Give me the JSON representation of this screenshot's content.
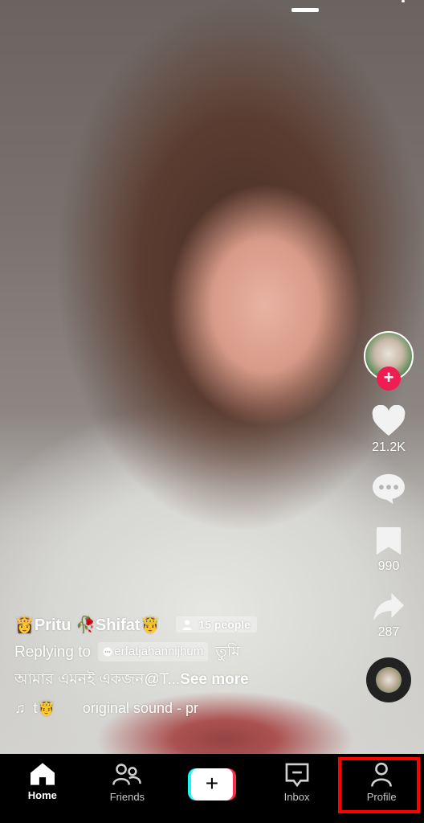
{
  "video": {
    "caption": {
      "username": "👸Pritu 🥀Shifat🤴",
      "viewer_badge": "15 people",
      "replying_prefix": "Replying to",
      "mention": "erfatjahannijhum",
      "text_line1_suffix": "তুমি",
      "text_line2": "আমার এমনই একজন@T...",
      "see_more": "See more",
      "sound_author": "t🤴",
      "sound_title": "original sound - pr"
    }
  },
  "rail": {
    "likes": "21.2K",
    "bookmarks": "990",
    "shares": "287",
    "follow_label": "+"
  },
  "nav": {
    "items": [
      {
        "label": "Home",
        "icon": "home-icon",
        "active": true
      },
      {
        "label": "Friends",
        "icon": "friends-icon"
      },
      {
        "label": "",
        "icon": "create-icon"
      },
      {
        "label": "Inbox",
        "icon": "inbox-icon"
      },
      {
        "label": "Profile",
        "icon": "profile-icon"
      }
    ],
    "create_symbol": "+"
  },
  "colors": {
    "accent": "#fe2c55",
    "cyan": "#25f4ee",
    "highlight": "#ff0000"
  }
}
